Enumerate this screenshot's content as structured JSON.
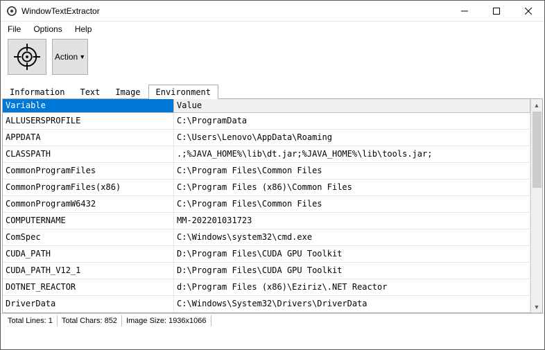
{
  "window": {
    "title": "WindowTextExtractor"
  },
  "menu": {
    "file": "File",
    "options": "Options",
    "help": "Help"
  },
  "toolbar": {
    "action_label": "Action"
  },
  "tabs": {
    "information": "Information",
    "text": "Text",
    "image": "Image",
    "environment": "Environment"
  },
  "table": {
    "header_variable": "Variable",
    "header_value": "Value",
    "rows": [
      {
        "variable": "ALLUSERSPROFILE",
        "value": "C:\\ProgramData"
      },
      {
        "variable": "APPDATA",
        "value": "C:\\Users\\Lenovo\\AppData\\Roaming"
      },
      {
        "variable": "CLASSPATH",
        "value": ".;%JAVA_HOME%\\lib\\dt.jar;%JAVA_HOME%\\lib\\tools.jar;"
      },
      {
        "variable": "CommonProgramFiles",
        "value": "C:\\Program Files\\Common Files"
      },
      {
        "variable": "CommonProgramFiles(x86)",
        "value": "C:\\Program Files (x86)\\Common Files"
      },
      {
        "variable": "CommonProgramW6432",
        "value": "C:\\Program Files\\Common Files"
      },
      {
        "variable": "COMPUTERNAME",
        "value": "MM-202201031723"
      },
      {
        "variable": "ComSpec",
        "value": "C:\\Windows\\system32\\cmd.exe"
      },
      {
        "variable": "CUDA_PATH",
        "value": "D:\\Program Files\\CUDA GPU Toolkit"
      },
      {
        "variable": "CUDA_PATH_V12_1",
        "value": "D:\\Program Files\\CUDA GPU Toolkit"
      },
      {
        "variable": "DOTNET_REACTOR",
        "value": "d:\\Program Files (x86)\\Eziriz\\.NET Reactor"
      },
      {
        "variable": "DriverData",
        "value": "C:\\Windows\\System32\\Drivers\\DriverData"
      }
    ]
  },
  "status": {
    "lines": "Total Lines: 1",
    "chars": "Total Chars: 852",
    "imgsize": "Image Size: 1936x1066"
  }
}
